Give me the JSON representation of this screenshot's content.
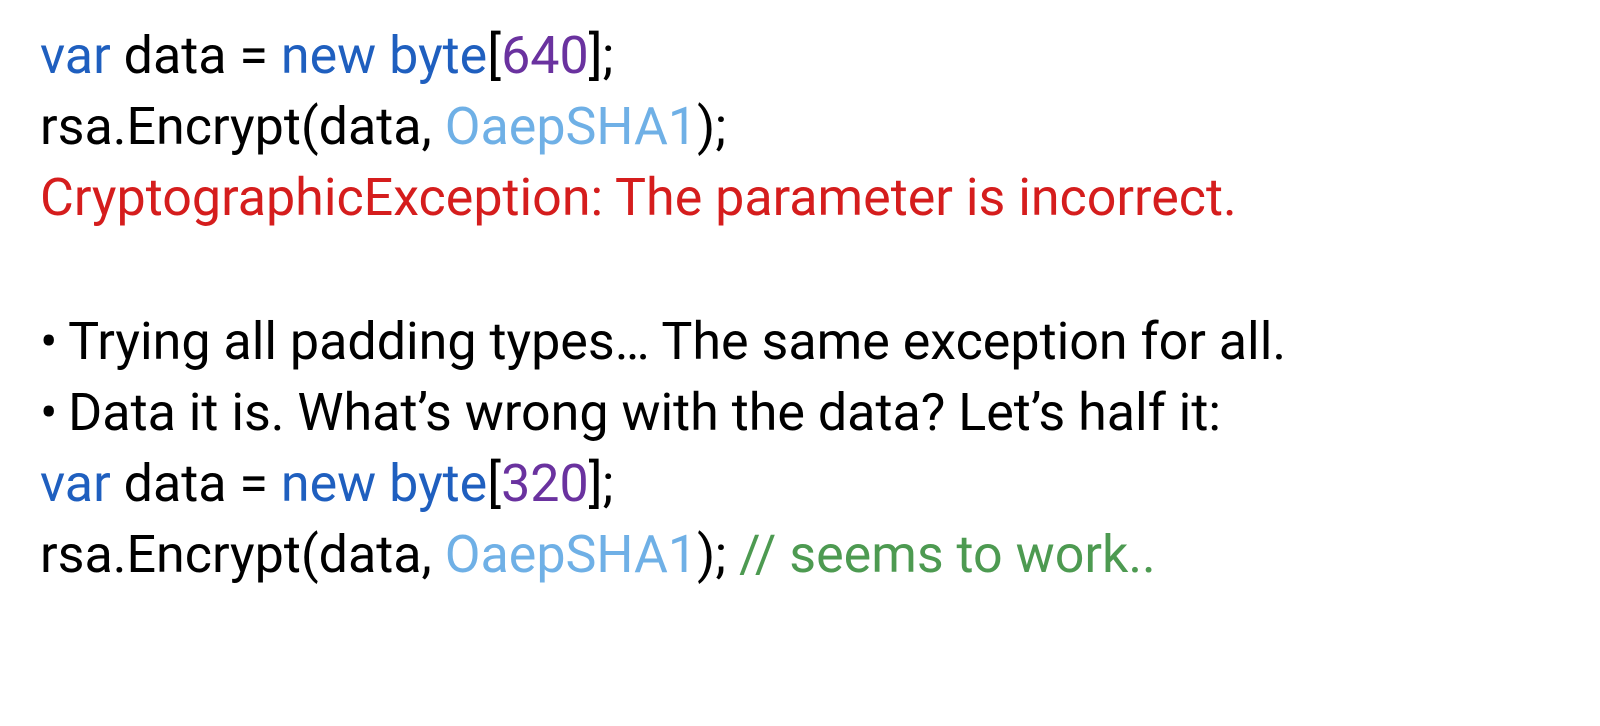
{
  "code1": {
    "var": "var",
    "data": " data = ",
    "new": "new",
    "byte": " byte",
    "lbr": "[",
    "num": "640",
    "rbr": "];"
  },
  "call1": {
    "pre": "rsa.Encrypt(data, ",
    "enum": "OaepSHA1",
    "post": ");"
  },
  "error": "CryptographicException: The parameter is incorrect.",
  "bullets": {
    "b1": "• Trying all padding types… The same exception for all.",
    "b2": "• Data it is. What’s wrong with the data? Let’s half it:"
  },
  "code2": {
    "var": "var",
    "data": " data = ",
    "new": "new",
    "byte": " byte",
    "lbr": "[",
    "num": "320",
    "rbr": "];"
  },
  "call2": {
    "pre": "rsa.Encrypt(data, ",
    "enum": "OaepSHA1",
    "post": "); ",
    "comment": "// seems to work.."
  }
}
